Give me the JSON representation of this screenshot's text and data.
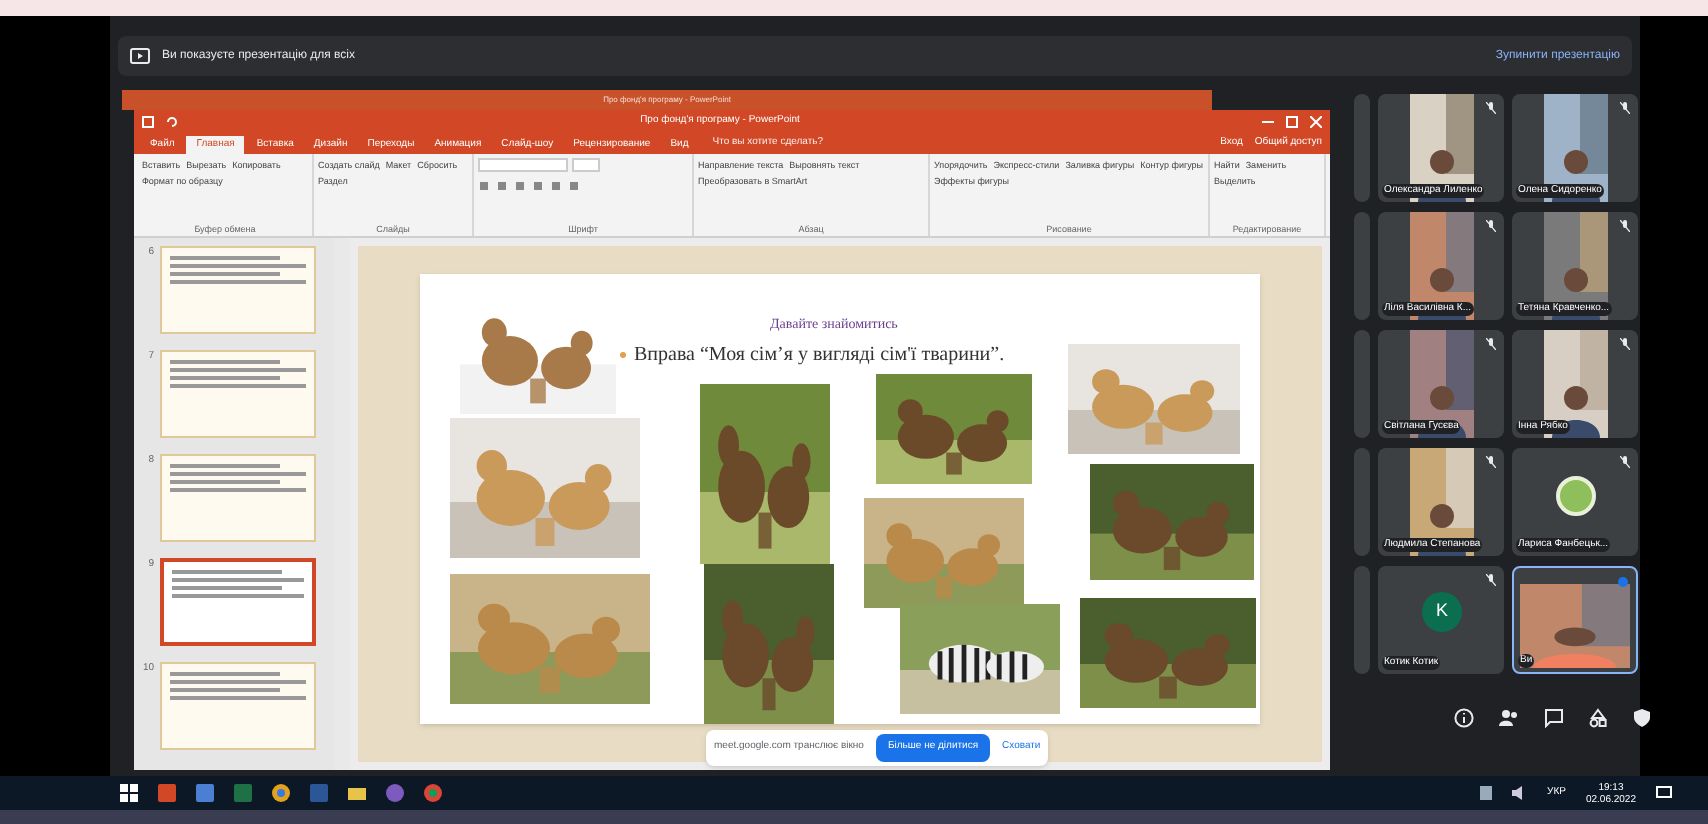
{
  "presentation_banner": {
    "message": "Ви показуєте презентацію для всіх",
    "stop_button": "Зупинити презентацію"
  },
  "powerpoint": {
    "back_window_title": "Про фонд'я програму - PowerPoint",
    "title": "Про фонд'я програму - PowerPoint",
    "tabs": [
      {
        "label": "Файл",
        "selected": false
      },
      {
        "label": "Главная",
        "selected": true
      },
      {
        "label": "Вставка",
        "selected": false
      },
      {
        "label": "Дизайн",
        "selected": false
      },
      {
        "label": "Переходы",
        "selected": false
      },
      {
        "label": "Анимация",
        "selected": false
      },
      {
        "label": "Слайд-шоу",
        "selected": false
      },
      {
        "label": "Рецензирование",
        "selected": false
      },
      {
        "label": "Вид",
        "selected": false
      }
    ],
    "tell_me": "Что вы хотите сделать?",
    "sign_in": "Вход",
    "share": "Общий доступ",
    "ribbon_groups": [
      {
        "label": "Буфер обмена",
        "items": [
          "Вставить",
          "Вырезать",
          "Копировать",
          "Формат по образцу"
        ]
      },
      {
        "label": "Слайды",
        "items": [
          "Создать слайд",
          "Макет",
          "Сбросить",
          "Раздел"
        ]
      },
      {
        "label": "Шрифт"
      },
      {
        "label": "Абзац",
        "items": [
          "Направление текста",
          "Выровнять текст",
          "Преобразовать в SmartArt"
        ]
      },
      {
        "label": "Рисование",
        "items": [
          "Упорядочить",
          "Экспресс-стили",
          "Заливка фигуры",
          "Контур фигуры",
          "Эффекты фигуры"
        ]
      },
      {
        "label": "Редактирование",
        "items": [
          "Найти",
          "Заменить",
          "Выделить"
        ]
      }
    ],
    "thumbnails": [
      {
        "number": "6",
        "selected": false
      },
      {
        "number": "7",
        "selected": false
      },
      {
        "number": "8",
        "selected": false
      },
      {
        "number": "9",
        "selected": true
      },
      {
        "number": "10",
        "selected": false
      }
    ],
    "slide": {
      "heading": "Давайте знайомитись",
      "bullet": "Вправа “Моя сім’я у вигляді сім'ї тварини”."
    }
  },
  "sharing_bar": {
    "message": "meet.google.com транслює вікно",
    "stop_button": "Більше не ділитися",
    "hide_link": "Сховати"
  },
  "participants": [
    {
      "name": "Олександра Лиленко",
      "kind": "video"
    },
    {
      "name": "Олена Сидоренко",
      "kind": "video"
    },
    {
      "name": "Ліля Василівна К...",
      "kind": "video"
    },
    {
      "name": "Тетяна Кравченко...",
      "kind": "video"
    },
    {
      "name": "Світлана Гусєва",
      "kind": "video"
    },
    {
      "name": "Інна Рябко",
      "kind": "video"
    },
    {
      "name": "Людмила Степанова",
      "kind": "video"
    },
    {
      "name": "Лариса Фанбецьк..."
    },
    {
      "name": "Котик Котик",
      "kind": "letter",
      "initial": "K"
    },
    {
      "name": "Ви",
      "kind": "self"
    }
  ],
  "taskbar": {
    "language": "УКР",
    "time": "19:13",
    "date": "02.06.2022"
  }
}
